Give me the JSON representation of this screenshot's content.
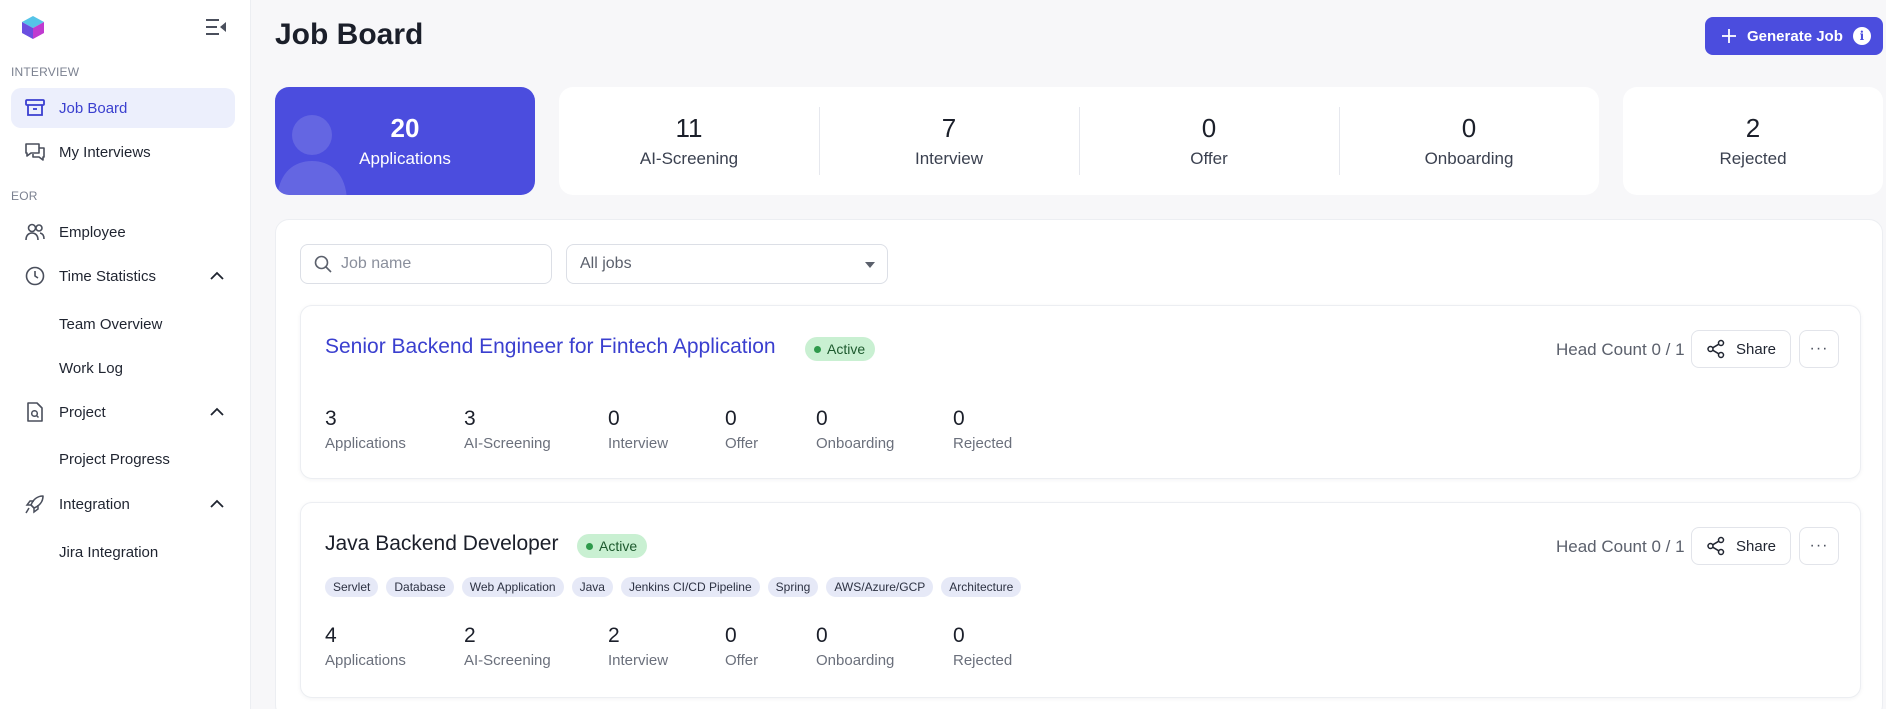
{
  "sidebar": {
    "sections": {
      "interview": "INTERVIEW",
      "eor": "EOR"
    },
    "items": {
      "job_board": "Job Board",
      "my_interviews": "My Interviews",
      "employee": "Employee",
      "time_statistics": "Time Statistics",
      "team_overview": "Team Overview",
      "work_log": "Work Log",
      "project": "Project",
      "project_progress": "Project Progress",
      "integration": "Integration",
      "jira_integration": "Jira Integration"
    }
  },
  "header": {
    "title": "Job Board",
    "generate_button": "Generate Job",
    "info_icon": "i"
  },
  "stats": {
    "applications": {
      "value": "20",
      "label": "Applications"
    },
    "ai_screening": {
      "value": "11",
      "label": "AI-Screening"
    },
    "interview": {
      "value": "7",
      "label": "Interview"
    },
    "offer": {
      "value": "0",
      "label": "Offer"
    },
    "onboarding": {
      "value": "0",
      "label": "Onboarding"
    },
    "rejected": {
      "value": "2",
      "label": "Rejected"
    }
  },
  "filters": {
    "search_placeholder": "Job name",
    "select_value": "All jobs"
  },
  "jobs": [
    {
      "title": "Senior Backend Engineer for Fintech Application",
      "status": "Active",
      "head_count": "Head Count 0 / 1",
      "share_label": "Share",
      "more_label": "···",
      "stats": [
        {
          "value": "3",
          "label": "Applications"
        },
        {
          "value": "3",
          "label": "AI-Screening"
        },
        {
          "value": "0",
          "label": "Interview"
        },
        {
          "value": "0",
          "label": "Offer"
        },
        {
          "value": "0",
          "label": "Onboarding"
        },
        {
          "value": "0",
          "label": "Rejected"
        }
      ],
      "tags": []
    },
    {
      "title": "Java Backend Developer",
      "status": "Active",
      "head_count": "Head Count 0 / 1",
      "share_label": "Share",
      "more_label": "···",
      "stats": [
        {
          "value": "4",
          "label": "Applications"
        },
        {
          "value": "2",
          "label": "AI-Screening"
        },
        {
          "value": "2",
          "label": "Interview"
        },
        {
          "value": "0",
          "label": "Offer"
        },
        {
          "value": "0",
          "label": "Onboarding"
        },
        {
          "value": "0",
          "label": "Rejected"
        }
      ],
      "tags": [
        "Servlet",
        "Database",
        "Web Application",
        "Java",
        "Jenkins CI/CD Pipeline",
        "Spring",
        "AWS/Azure/GCP",
        "Architecture"
      ]
    }
  ],
  "colors": {
    "brand": "#4b4dde",
    "active_nav_bg": "#eceffc",
    "badge_bg": "#c9f0d2",
    "badge_dot": "#2e9a4b",
    "link": "#3a3fcf"
  },
  "icons": {
    "logo": "cube-logo-icon",
    "collapse": "sidebar-collapse-icon",
    "job_board": "archive-box-icon",
    "my_interviews": "chat-bubbles-icon",
    "employee": "users-icon",
    "time_statistics": "clock-icon",
    "project": "document-search-icon",
    "integration": "rocket-icon",
    "search": "search-icon",
    "share": "share-icon",
    "more": "ellipsis-icon",
    "plus": "plus-icon"
  }
}
